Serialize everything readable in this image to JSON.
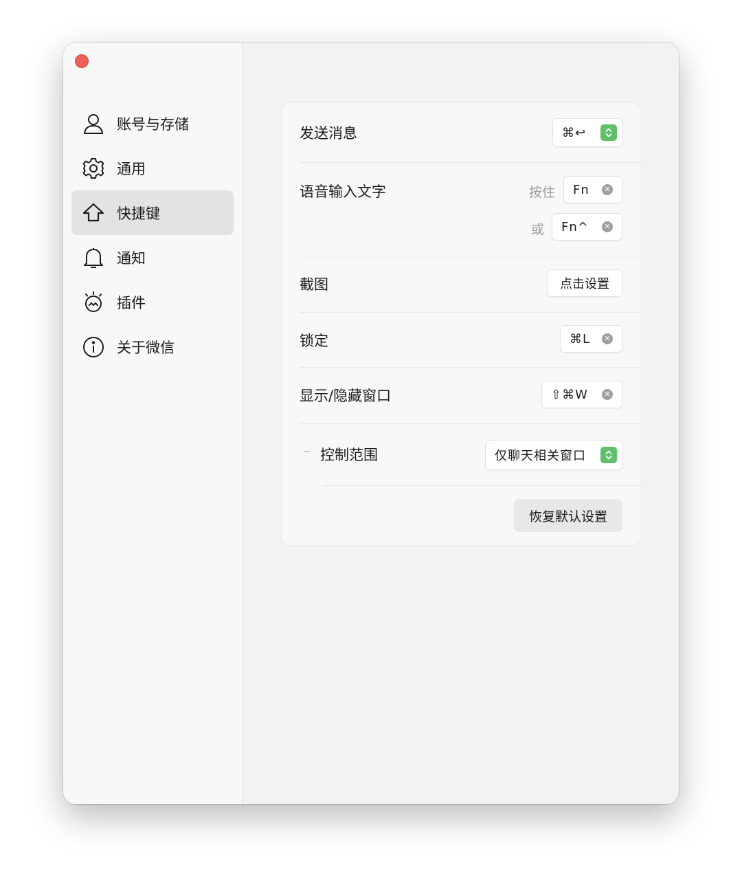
{
  "sidebar": {
    "items": [
      {
        "label": "账号与存储",
        "icon": "person-icon"
      },
      {
        "label": "通用",
        "icon": "gear-icon"
      },
      {
        "label": "快捷键",
        "icon": "shortcut-icon",
        "active": true
      },
      {
        "label": "通知",
        "icon": "bell-icon"
      },
      {
        "label": "插件",
        "icon": "plugin-icon"
      },
      {
        "label": "关于微信",
        "icon": "info-icon"
      }
    ]
  },
  "shortcuts": {
    "send_message": {
      "label": "发送消息",
      "keys": "⌘↩"
    },
    "voice_input": {
      "label": "语音输入文字",
      "hold_label": "按住",
      "hold_keys": "Fn",
      "or_label": "或",
      "alt_keys": "Fn^"
    },
    "screenshot": {
      "label": "截图",
      "action": "点击设置"
    },
    "lock": {
      "label": "锁定",
      "keys": "⌘L"
    },
    "show_hide": {
      "label": "显示/隐藏窗口",
      "keys": "⇧⌘W"
    },
    "scope": {
      "dash": "–",
      "label": "控制范围",
      "value": "仅聊天相关窗口"
    },
    "reset_label": "恢复默认设置"
  },
  "colors": {
    "close": "#ee5f57",
    "accent_green": "#5fbf6a",
    "active_bg": "#e3e3e3"
  }
}
